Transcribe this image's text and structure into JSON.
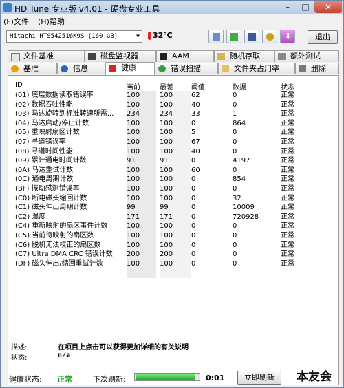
{
  "window": {
    "title": "HD Tune 专业版 v4.01 - 硬盘专业工具"
  },
  "menu": {
    "file": "(F)文件",
    "help": "(H)帮助"
  },
  "toolbar": {
    "drive": "Hitachi HTS542516K9S    (160 GB)",
    "temperature": "32℃",
    "exit_label": "退出"
  },
  "tabs_top": [
    "文件基准",
    "磁盘监视器",
    "AAM",
    "随机存取",
    "额外测试"
  ],
  "tabs_bottom": [
    "基准",
    "信息",
    "健康",
    "错误扫描",
    "文件夹占用率",
    "删除"
  ],
  "active_tab": "健康",
  "table": {
    "headers": {
      "id": "ID",
      "current": "当前",
      "worst": "最差",
      "threshold": "阈值",
      "data": "数据",
      "status": "状态"
    },
    "rows": [
      {
        "id": "(01) 底层数据读取错误率",
        "current": "100",
        "worst": "100",
        "threshold": "62",
        "data": "0",
        "status": "正常"
      },
      {
        "id": "(02) 数据吞吐性能",
        "current": "100",
        "worst": "100",
        "threshold": "40",
        "data": "0",
        "status": "正常"
      },
      {
        "id": "(03) 马达旋转到标准转速所需...",
        "current": "234",
        "worst": "234",
        "threshold": "33",
        "data": "1",
        "status": "正常"
      },
      {
        "id": "(04) 马达启动/停止计数",
        "current": "100",
        "worst": "100",
        "threshold": "0",
        "data": "864",
        "status": "正常"
      },
      {
        "id": "(05) 重映射扇区计数",
        "current": "100",
        "worst": "100",
        "threshold": "5",
        "data": "0",
        "status": "正常"
      },
      {
        "id": "(07) 寻道错误率",
        "current": "100",
        "worst": "100",
        "threshold": "67",
        "data": "0",
        "status": "正常"
      },
      {
        "id": "(08) 寻道时间性能",
        "current": "100",
        "worst": "100",
        "threshold": "40",
        "data": "0",
        "status": "正常"
      },
      {
        "id": "(09) 累计通电时间计数",
        "current": "91",
        "worst": "91",
        "threshold": "0",
        "data": "4197",
        "status": "正常"
      },
      {
        "id": "(0A) 马达重试计数",
        "current": "100",
        "worst": "100",
        "threshold": "60",
        "data": "0",
        "status": "正常"
      },
      {
        "id": "(0C) 通电周期计数",
        "current": "100",
        "worst": "100",
        "threshold": "0",
        "data": "854",
        "status": "正常"
      },
      {
        "id": "(BF) 振动感测错误率",
        "current": "100",
        "worst": "100",
        "threshold": "0",
        "data": "0",
        "status": "正常"
      },
      {
        "id": "(C0) 断电磁头缩回计数",
        "current": "100",
        "worst": "100",
        "threshold": "0",
        "data": "32",
        "status": "正常"
      },
      {
        "id": "(C1) 磁头伸出周期计数",
        "current": "99",
        "worst": "99",
        "threshold": "0",
        "data": "10009",
        "status": "正常"
      },
      {
        "id": "(C2) 温度",
        "current": "171",
        "worst": "171",
        "threshold": "0",
        "data": "720928",
        "status": "正常"
      },
      {
        "id": "(C4) 重新映射的扇区事件计数",
        "current": "100",
        "worst": "100",
        "threshold": "0",
        "data": "0",
        "status": "正常"
      },
      {
        "id": "(C5) 当前待映射的扇区数",
        "current": "100",
        "worst": "100",
        "threshold": "0",
        "data": "0",
        "status": "正常"
      },
      {
        "id": "(C6) 脱机无法校正的扇区数",
        "current": "100",
        "worst": "100",
        "threshold": "0",
        "data": "0",
        "status": "正常"
      },
      {
        "id": "(C7) Ultra DMA CRC 错误计数",
        "current": "200",
        "worst": "200",
        "threshold": "0",
        "data": "0",
        "status": "正常"
      },
      {
        "id": "(DF) 磁头伸出/缩回重试计数",
        "current": "100",
        "worst": "100",
        "threshold": "0",
        "data": "0",
        "status": "正常"
      }
    ]
  },
  "detail": {
    "desc_label": "描述:",
    "desc_value": "在项目上点击可以获得更加详细的有关说明",
    "status_label": "状态:",
    "status_value": "n/a"
  },
  "statusbar": {
    "health_label": "健康状态:",
    "health_value": "正常",
    "refresh_label": "下次刷新:",
    "timer": "0:01",
    "refresh_button": "立即刷新",
    "progress": 0.95
  },
  "watermark": "本友会",
  "colors": {
    "ok_green": "#1a9a1a",
    "progress_green": "#2fbf3a"
  }
}
